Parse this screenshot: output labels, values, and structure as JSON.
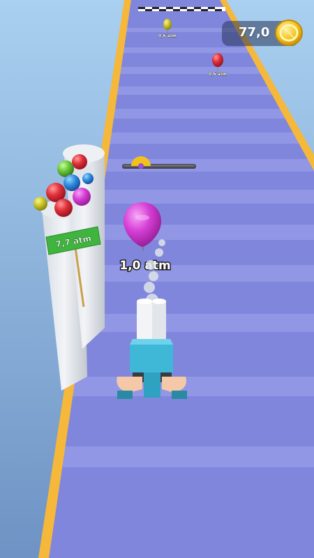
{
  "hud": {
    "coins": "77,0",
    "coin_icon": "gold-coin-icon"
  },
  "player_balloon": {
    "pressure": "1,0 atm",
    "color": "#d63fd6"
  },
  "side_tower": {
    "sign_text": "7,7 atm",
    "sign_color": "#3fb43f"
  },
  "track_balloons": [
    {
      "pressure": "0,6 atm",
      "color": "#c9c62a"
    },
    {
      "pressure": "0,6 atm",
      "color": "#e0303a"
    }
  ],
  "colors": {
    "track": "#7f86dc",
    "track_stripe": "#a8aef0",
    "rail": "#f5b83a",
    "pump": "#3fb8d8"
  }
}
